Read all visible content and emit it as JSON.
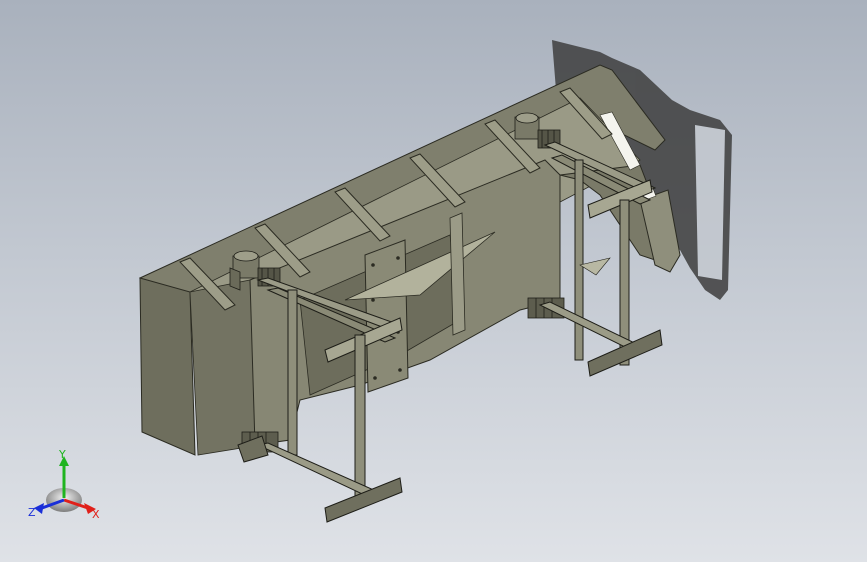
{
  "viewport": {
    "background_top": "#a9b1bd",
    "background_bottom": "#dfe2e7"
  },
  "model": {
    "body_color": "#8c8c78",
    "body_dark": "#5e5e4f",
    "body_light": "#b0b09a",
    "edge_color": "#2b2b22",
    "shadow_color": "#3f3f3f"
  },
  "triad": {
    "x_label": "X",
    "y_label": "Y",
    "z_label": "Z",
    "x_color": "#e0201a",
    "y_color": "#1fb41f",
    "z_color": "#1a2fd8"
  }
}
